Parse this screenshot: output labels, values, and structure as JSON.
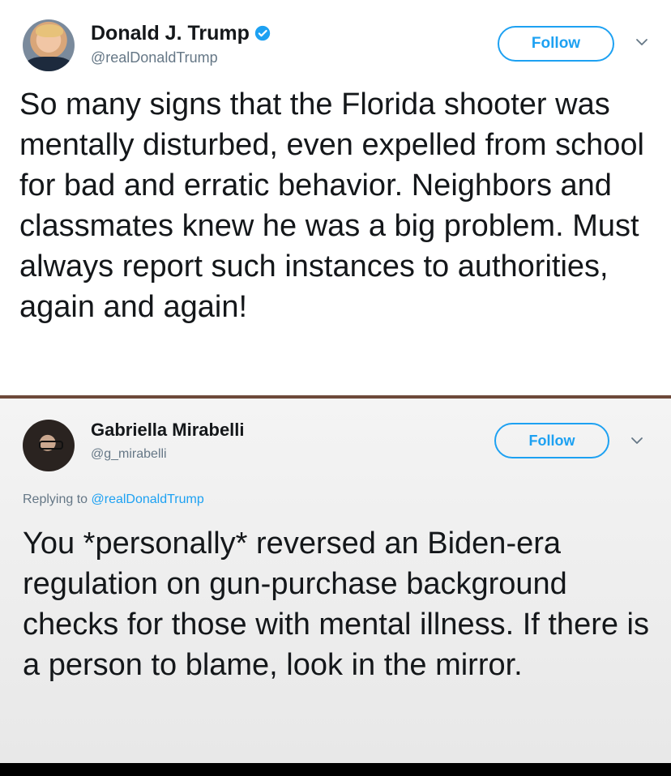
{
  "tweets": [
    {
      "author": {
        "name": "Donald J. Trump",
        "handle": "@realDonaldTrump",
        "verified": true
      },
      "follow_label": "Follow",
      "text": "So many signs that the Florida shooter was mentally disturbed, even expelled from school for bad and erratic behavior. Neighbors and classmates knew he was a big problem. Must always report such instances to authorities, again and again!"
    },
    {
      "author": {
        "name": "Gabriella Mirabelli",
        "handle": "@g_mirabelli",
        "verified": false
      },
      "follow_label": "Follow",
      "replying_prefix": "Replying to",
      "replying_to": "@realDonaldTrump",
      "text": "You *personally* reversed an Biden-era regulation on gun-purchase background checks for those with mental illness. If there is a person to blame, look in the mirror."
    }
  ],
  "colors": {
    "accent": "#1da1f2",
    "text": "#14171a",
    "secondary_text": "#657786",
    "divider": "#6e4a3a"
  },
  "icons": {
    "verified": "verified-badge-icon",
    "menu": "chevron-down-icon"
  }
}
